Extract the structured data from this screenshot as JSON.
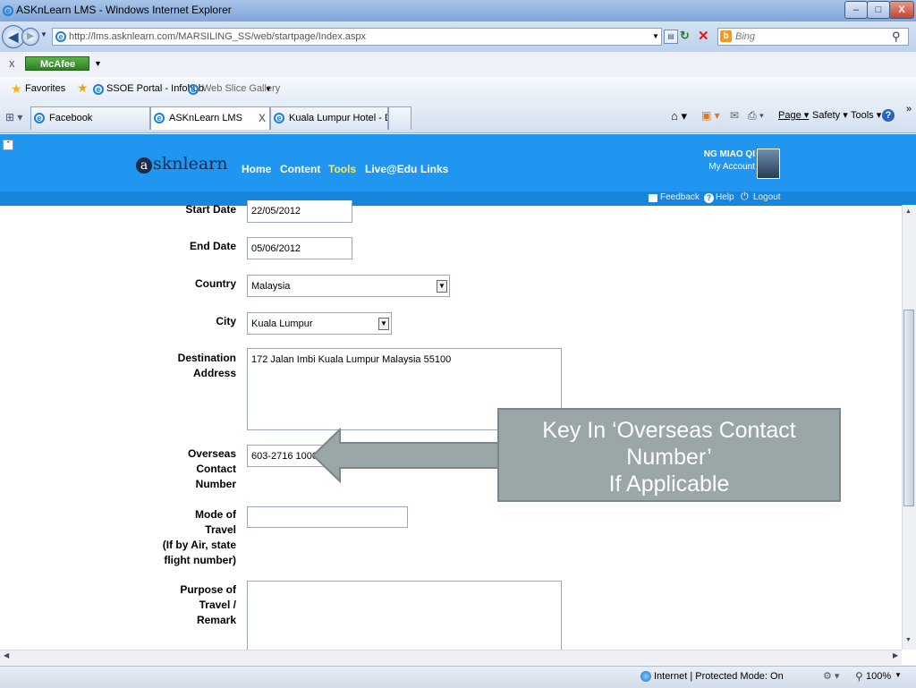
{
  "window": {
    "title": "ASKnLearn LMS - Windows Internet Explorer",
    "minimize": "–",
    "maximize": "□",
    "close": "X"
  },
  "address_bar": {
    "url": "http://lms.asknlearn.com/MARSILING_SS/web/startpage/Index.aspx",
    "search_placeholder": "Bing"
  },
  "toolbar": {
    "close": "x",
    "mcafee": "McAfee",
    "favorites": "Favorites",
    "fav_links": [
      "SSOE Portal - Infohub",
      "Web Slice Gallery"
    ]
  },
  "tabs": {
    "items": [
      {
        "label": "Facebook"
      },
      {
        "label": "ASKnLearn LMS"
      },
      {
        "label": "Kuala Lumpur Hotel - Dors..."
      }
    ],
    "close": "X"
  },
  "commands": {
    "page": "Page",
    "safety": "Safety",
    "tools": "Tools"
  },
  "site": {
    "logo": "sknlearn",
    "logo_letter": "a",
    "nav": [
      "Home",
      "Content",
      "Tools",
      "Live@Edu",
      "Links"
    ],
    "user_name": "NG MIAO QI",
    "my_account": "My Account",
    "feedback": "Feedback",
    "help": "Help",
    "logout": "Logout"
  },
  "form": {
    "start_date": {
      "label": "Start Date",
      "value": "22/05/2012"
    },
    "end_date": {
      "label": "End Date",
      "value": "05/06/2012"
    },
    "country": {
      "label": "Country",
      "value": "Malaysia"
    },
    "city": {
      "label": "City",
      "value": "Kuala Lumpur"
    },
    "destination": {
      "label_1": "Destination",
      "label_2": "Address",
      "value": "172 Jalan Imbi Kuala Lumpur Malaysia 55100"
    },
    "overseas": {
      "label_1": "Overseas",
      "label_2": "Contact",
      "label_3": "Number",
      "value": "603-2716 1000"
    },
    "mode": {
      "label_1": "Mode of",
      "label_2": "Travel",
      "label_3": "(If by Air, state",
      "label_4": "flight number)",
      "value": ""
    },
    "purpose": {
      "label_1": "Purpose of",
      "label_2": "Travel /",
      "label_3": "Remark",
      "value": ""
    }
  },
  "callout": {
    "line1": "Key In ‘Overseas Contact",
    "line2": "Number’",
    "line3": "If Applicable"
  },
  "status": {
    "zone": "Internet | Protected Mode: On",
    "zoom": "100%"
  },
  "colors": {
    "header": "#2196f0",
    "nav_current": "#ffe84a",
    "callout": "#9aa6a8"
  }
}
